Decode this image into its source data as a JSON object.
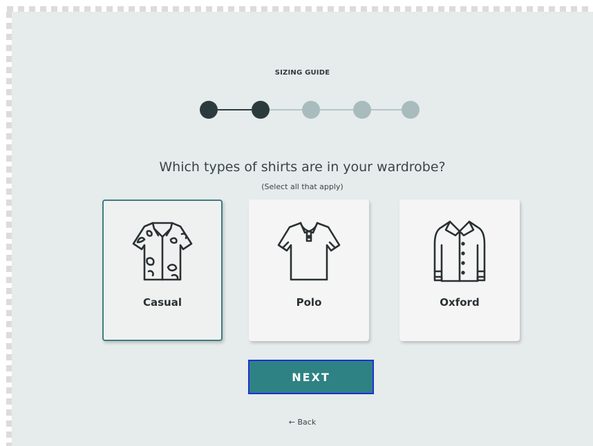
{
  "header": {
    "eyebrow": "SIZING GUIDE"
  },
  "progress": {
    "total_steps": 5,
    "completed_steps": 2,
    "colors": {
      "done": "#2b3b3d",
      "todo": "#a8bcbd"
    }
  },
  "question": {
    "title": "Which types of shirts are in your wardrobe?",
    "hint": "(Select all that apply)"
  },
  "options": [
    {
      "label": "Casual",
      "icon": "hawaiian-shirt-icon",
      "selected": true
    },
    {
      "label": "Polo",
      "icon": "polo-shirt-icon",
      "selected": false
    },
    {
      "label": "Oxford",
      "icon": "oxford-shirt-icon",
      "selected": false
    }
  ],
  "actions": {
    "next_label": "NEXT",
    "back_label": "← Back"
  },
  "colors": {
    "accent": "#2f8283",
    "selected_border": "#3d7d80",
    "focus_outline": "#1f2fd6",
    "panel_bg": "#e6ebeb"
  }
}
